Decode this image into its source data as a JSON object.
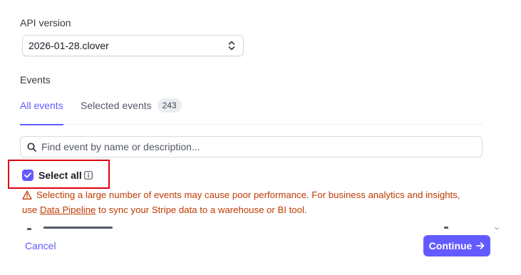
{
  "api_version": {
    "label": "API version",
    "selected": "2026-01-28.clover"
  },
  "events": {
    "label": "Events",
    "tabs": [
      {
        "label": "All events",
        "active": true
      },
      {
        "label": "Selected events",
        "badge": "243",
        "active": false
      }
    ],
    "search": {
      "placeholder": "Find event by name or description..."
    },
    "select_all": {
      "label": "Select all",
      "checked": true
    },
    "warning": {
      "text_before": "Selecting a large number of events may cause poor performance. For business analytics and insights,",
      "line2_before": "use ",
      "link": "Data Pipeline",
      "text_after": " to sync your Stripe data to a warehouse or BI tool."
    }
  },
  "footer": {
    "cancel": "Cancel",
    "continue": "Continue"
  },
  "colors": {
    "accent": "#635bff",
    "warning": "#c03a00",
    "highlight": "#e0000f"
  }
}
